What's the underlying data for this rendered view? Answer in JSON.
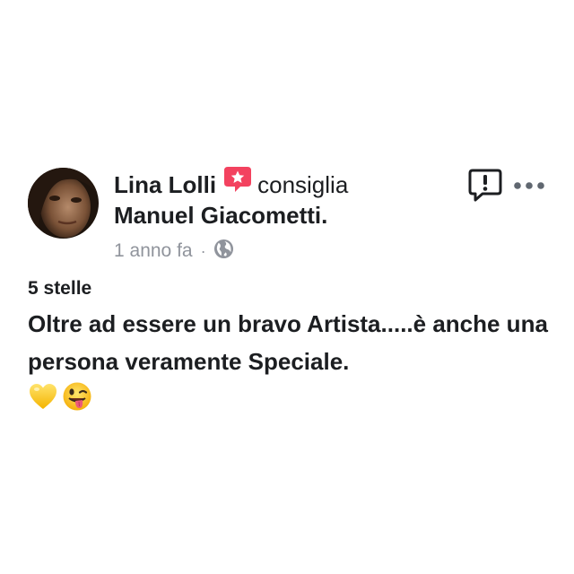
{
  "post": {
    "author": "Lina Lolli",
    "verb": "consiglia",
    "page_name": "Manuel Giacometti",
    "page_name_suffix": ".",
    "timestamp": "1 anno fa",
    "separator": "·",
    "privacy_icon": "globe-icon",
    "recommend_icon": "recommend-star-badge-icon",
    "actions": {
      "report_icon": "report-exclamation-icon",
      "more_icon": "more-dots-icon"
    },
    "rating": "5 stelle",
    "review": "Oltre ad essere un bravo Artista.....è anche una persona veramente Speciale.",
    "emojis": [
      "yellow-heart-emoji",
      "winking-tongue-emoji"
    ]
  },
  "colors": {
    "text": "#1c1e21",
    "meta": "#90949c",
    "badge": "#f3425f",
    "icon": "#1c1e21"
  }
}
